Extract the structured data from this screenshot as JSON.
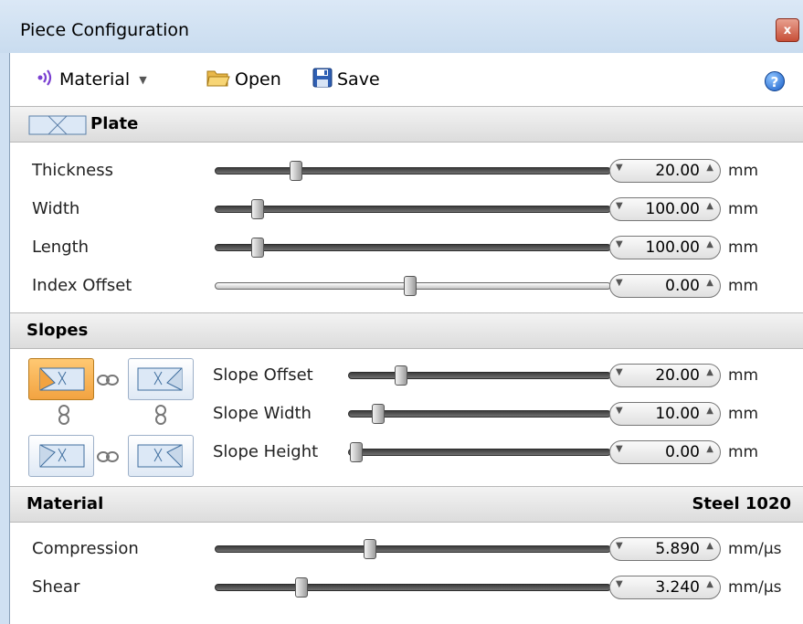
{
  "window": {
    "title": "Piece Configuration",
    "close_label": "x"
  },
  "toolbar": {
    "material_label": "Material",
    "open_label": "Open",
    "save_label": "Save",
    "help_label": "?"
  },
  "plate": {
    "title": "Plate",
    "rows": [
      {
        "label": "Thickness",
        "value": "20.00",
        "unit": "mm",
        "level": 0.21
      },
      {
        "label": "Width",
        "value": "100.00",
        "unit": "mm",
        "level": 0.11
      },
      {
        "label": "Length",
        "value": "100.00",
        "unit": "mm",
        "level": 0.11
      },
      {
        "label": "Index Offset",
        "value": "0.00",
        "unit": "mm",
        "level": 0.5
      }
    ]
  },
  "slopes": {
    "title": "Slopes",
    "rows": [
      {
        "label": "Slope Offset",
        "value": "20.00",
        "unit": "mm",
        "level": 0.2
      },
      {
        "label": "Slope Width",
        "value": "10.00",
        "unit": "mm",
        "level": 0.1
      },
      {
        "label": "Slope Height",
        "value": "0.00",
        "unit": "mm",
        "level": 0.0
      }
    ]
  },
  "material": {
    "title": "Material",
    "value": "Steel 1020",
    "rows": [
      {
        "label": "Compression",
        "value": "5.890",
        "unit": "mm/µs",
        "level": 0.4
      },
      {
        "label": "Shear",
        "value": "3.240",
        "unit": "mm/µs",
        "level": 0.22
      }
    ]
  }
}
